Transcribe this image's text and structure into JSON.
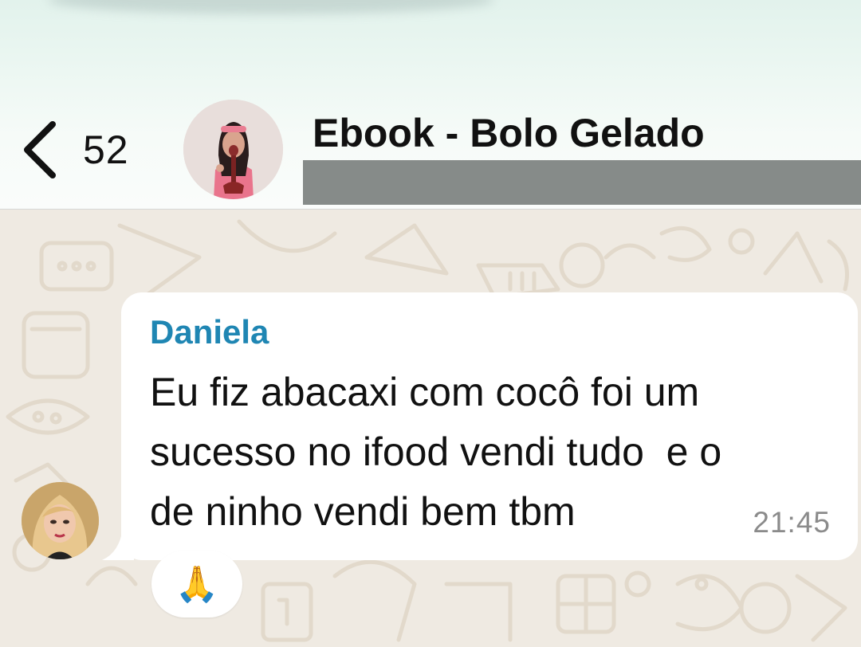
{
  "header": {
    "back_count": "52",
    "group_title": "Ebook - Bolo Gelado"
  },
  "message": {
    "sender": "Daniela",
    "text": "Eu fiz abacaxi com cocô foi um\nsucesso no ifood vendi tudo  e o\nde ninho vendi bem tbm",
    "time": "21:45",
    "reaction": "🙏"
  },
  "colors": {
    "sender_name": "#1f86b3",
    "chat_background": "#efeae2",
    "bubble": "#ffffff",
    "timestamp": "#8b8b8b"
  },
  "icons": {
    "back": "chevron-left-icon"
  }
}
